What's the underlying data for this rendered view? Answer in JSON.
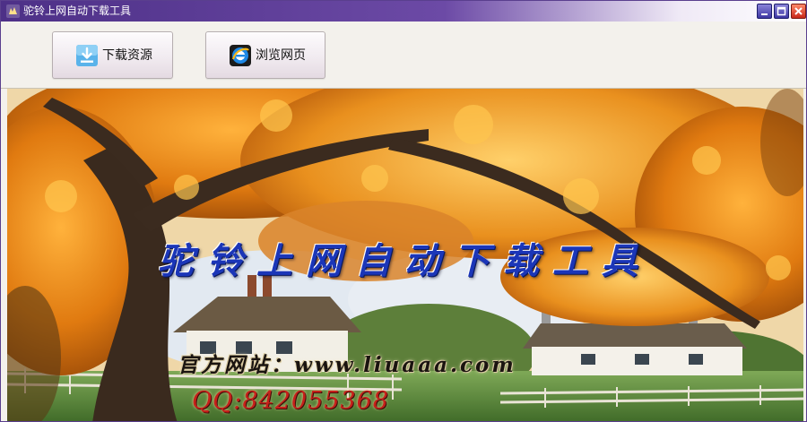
{
  "window": {
    "title": "驼铃上网自动下载工具",
    "accent_color": "#4d3087"
  },
  "title_bar": {
    "buttons": [
      "minimize",
      "maximize",
      "close"
    ]
  },
  "toolbar": {
    "download_label": "下载资源",
    "download_icon": "download-arrow-icon",
    "browse_label": "浏览网页",
    "browse_icon": "internet-explorer-icon"
  },
  "banner": {
    "title": "驼铃上网自动下载工具",
    "site_line": "官方网站：www.liuaaa.com",
    "qq_line": "QQ:842055368",
    "title_color": "#1b36b8",
    "qq_color": "#c6201a"
  }
}
